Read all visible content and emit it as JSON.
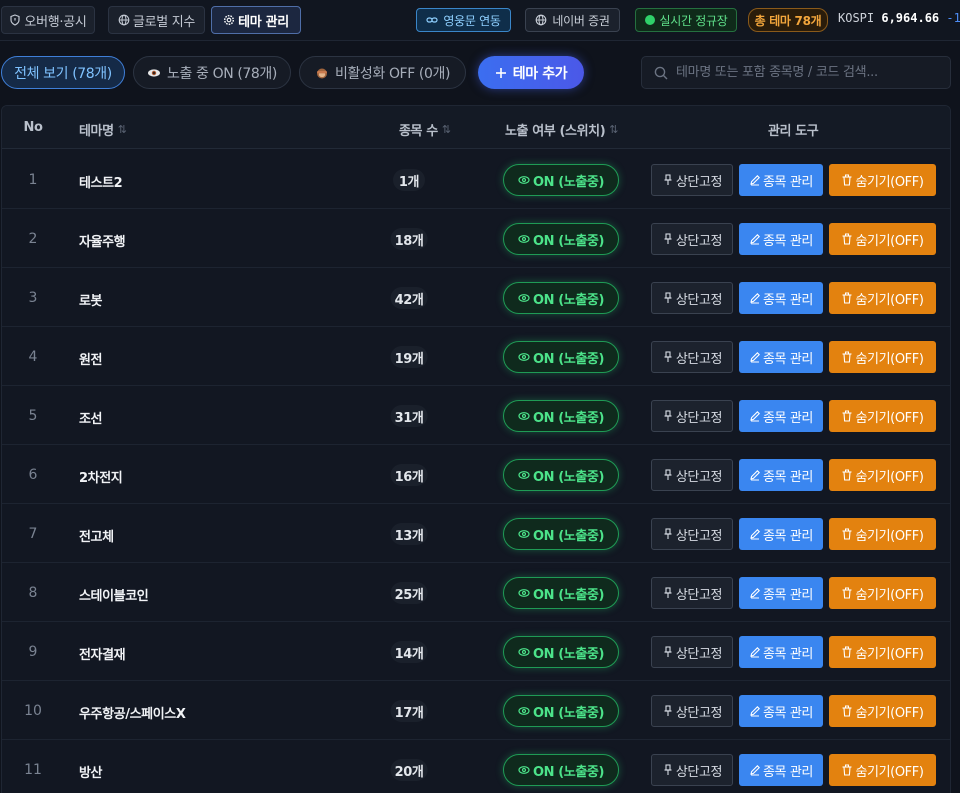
{
  "topnav": {
    "tabs": [
      {
        "label": "오버행·공시",
        "icon": "shield-icon"
      },
      {
        "label": "글로벌 지수",
        "icon": "globe-icon"
      },
      {
        "label": "테마 관리",
        "icon": "gear-icon",
        "active": true
      }
    ],
    "link_label": "영웅문 연동",
    "naver_label": "네이버 증권",
    "live_label": "실시간 정규장",
    "total_label": "총 테마 78개",
    "kospi": {
      "name": "KOSPI",
      "value": "6,964.66",
      "change": "-1"
    }
  },
  "filters": {
    "all_label": "전체 보기 (78개)",
    "on_label": "노출 중 ON (78개)",
    "off_label": "비활성화 OFF (0개)",
    "add_label": "테마 추가"
  },
  "search": {
    "placeholder": "테마명 또는 포함 종목명 / 코드 검색...",
    "value": ""
  },
  "table": {
    "headers": {
      "no": "No",
      "name": "테마명",
      "count": "종목 수",
      "toggle": "노출 여부 (스위치)",
      "tools": "관리 도구"
    },
    "toggle_on_label": "ON (노출중)",
    "pin_label": "상단고정",
    "manage_label": "종목 관리",
    "hide_label": "숨기기(OFF)",
    "rows": [
      {
        "no": "1",
        "name": "테스트2",
        "count": "1개"
      },
      {
        "no": "2",
        "name": "자율주행",
        "count": "18개"
      },
      {
        "no": "3",
        "name": "로봇",
        "count": "42개"
      },
      {
        "no": "4",
        "name": "원전",
        "count": "19개"
      },
      {
        "no": "5",
        "name": "조선",
        "count": "31개"
      },
      {
        "no": "6",
        "name": "2차전지",
        "count": "16개"
      },
      {
        "no": "7",
        "name": "전고체",
        "count": "13개"
      },
      {
        "no": "8",
        "name": "스테이블코인",
        "count": "25개"
      },
      {
        "no": "9",
        "name": "전자결재",
        "count": "14개"
      },
      {
        "no": "10",
        "name": "우주항공/스페이스X",
        "count": "17개"
      },
      {
        "no": "11",
        "name": "방산",
        "count": "20개"
      }
    ]
  },
  "colors": {
    "accent": "#3a86f0",
    "on": "#4ce38a",
    "hide": "#e3820f",
    "bg": "#0f131c"
  }
}
